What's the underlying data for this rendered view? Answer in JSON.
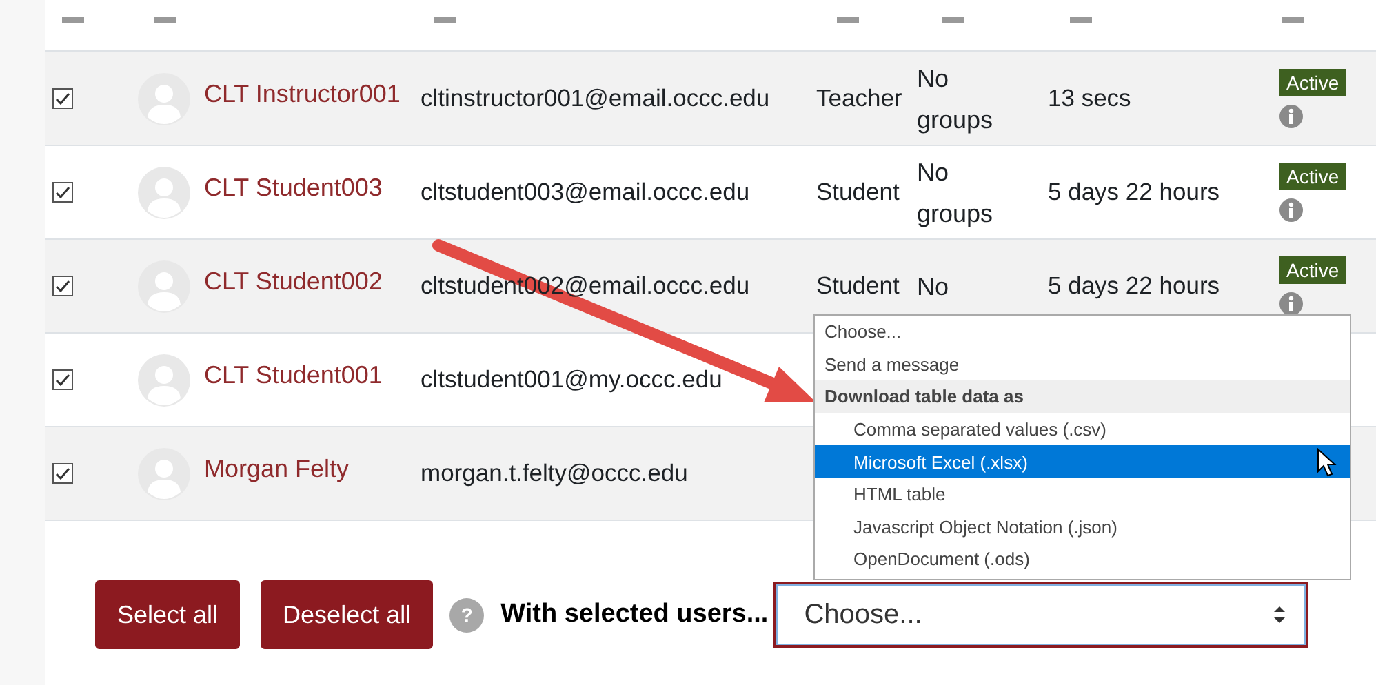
{
  "table": {
    "rows": [
      {
        "checked": true,
        "name": "CLT Instructor001",
        "email": "cltinstructor001@email.occc.edu",
        "role": "Teacher",
        "groups": "No groups",
        "last_access": "13 secs",
        "status": "Active"
      },
      {
        "checked": true,
        "name": "CLT Student003",
        "email": "cltstudent003@email.occc.edu",
        "role": "Student",
        "groups": "No groups",
        "last_access": "5 days 22 hours",
        "status": "Active"
      },
      {
        "checked": true,
        "name": "CLT Student002",
        "email": "cltstudent002@email.occc.edu",
        "role": "Student",
        "groups": "No",
        "last_access": "5 days 22 hours",
        "status": "Active"
      },
      {
        "checked": true,
        "name": "CLT Student001",
        "email": "cltstudent001@my.occc.edu"
      },
      {
        "checked": true,
        "name": "Morgan Felty",
        "email": "morgan.t.felty@occc.edu"
      }
    ]
  },
  "actions": {
    "buttons": [
      "Select all",
      "Deselect all"
    ],
    "help": "?",
    "label": "With selected users...",
    "select": {
      "value": "Choose...",
      "expanded": true
    }
  },
  "dropdown": {
    "items": [
      {
        "kind": "option",
        "label": "Choose...",
        "selected": false
      },
      {
        "kind": "option",
        "label": "Send a message",
        "selected": false
      },
      {
        "kind": "group",
        "label": "Download table data as",
        "children": [
          {
            "kind": "option",
            "label": "Comma separated values (.csv)",
            "selected": false
          },
          {
            "kind": "option",
            "label": "Microsoft Excel (.xlsx)",
            "selected": true
          },
          {
            "kind": "option",
            "label": "HTML table",
            "selected": false
          },
          {
            "kind": "option",
            "label": "Javascript Object Notation (.json)",
            "selected": false
          },
          {
            "kind": "option",
            "label": "OpenDocument (.ods)",
            "selected": false
          }
        ]
      }
    ]
  }
}
